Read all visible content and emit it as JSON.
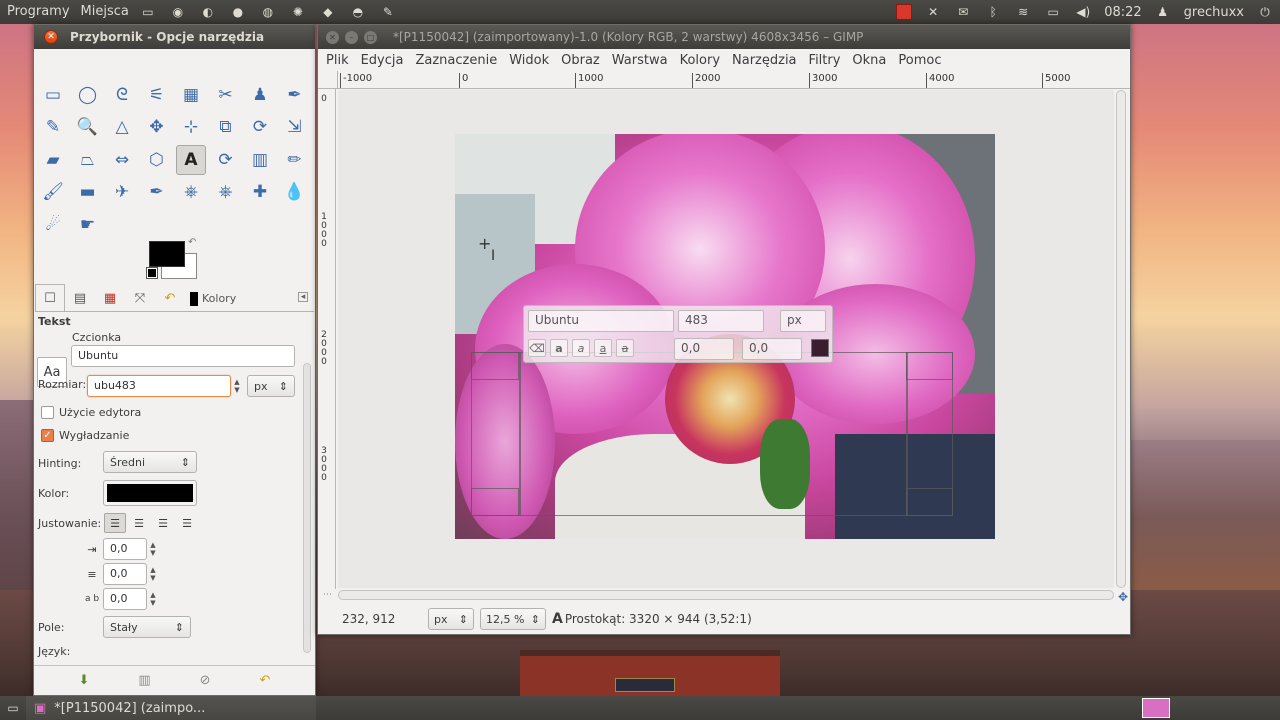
{
  "top_panel": {
    "programs": "Programy",
    "places": "Miejsca",
    "time": "08:22",
    "user": "grechuxx"
  },
  "toolbox": {
    "title": "Przybornik - Opcje narzędzia",
    "tools": [
      "rect-select",
      "ellipse-select",
      "free-select",
      "fuzzy-select",
      "color-select",
      "scissors-select",
      "foreground-select",
      "paths",
      "color-picker",
      "zoom",
      "measure",
      "move",
      "align",
      "crop",
      "rotate",
      "scale",
      "shear",
      "perspective",
      "flip",
      "cage-transform",
      "text",
      "heal",
      "blend",
      "pencil",
      "paintbrush",
      "eraser",
      "airbrush",
      "ink",
      "clone",
      "perspective-clone",
      "heal-bandaid",
      "blur",
      "dodge",
      "smudge"
    ],
    "dock_tab_colors": "Kolory",
    "options": {
      "section": "Tekst",
      "font_label": "Czcionka",
      "font_preview": "Aa",
      "font_value": "Ubuntu",
      "size_label": "Rozmiar:",
      "size_value": "ubu483",
      "size_unit": "px",
      "use_editor": "Użycie edytora",
      "antialias": "Wygładzanie",
      "hinting_label": "Hinting:",
      "hinting_value": "Średni",
      "color_label": "Kolor:",
      "justify_label": "Justowanie:",
      "indent": "0,0",
      "line_spacing": "0,0",
      "letter_spacing": "0,0",
      "box_label": "Pole:",
      "box_value": "Stały",
      "language_label": "Język:"
    }
  },
  "image_window": {
    "title": "*[P1150042] (zaimportowany)-1.0 (Kolory RGB, 2 warstwy) 4608x3456 – GIMP",
    "menu": [
      "Plik",
      "Edycja",
      "Zaznaczenie",
      "Widok",
      "Obraz",
      "Warstwa",
      "Kolory",
      "Narzędzia",
      "Filtry",
      "Okna",
      "Pomoc"
    ],
    "hruler": [
      "-1000",
      "0",
      "1000",
      "2000",
      "3000",
      "4000",
      "5000"
    ],
    "vruler": [
      "0",
      "1000",
      "2000",
      "3000"
    ],
    "text_toolbar": {
      "font": "Ubuntu",
      "size": "483",
      "unit": "px",
      "baseline": "0,0",
      "kerning": "0,0"
    },
    "status": {
      "coords": "232, 912",
      "unit": "px",
      "zoom": "12,5 %",
      "message": "Prostokąt: 3320 × 944  (3,52:1)"
    }
  },
  "taskbar": {
    "item": "*[P1150042] (zaimpo..."
  },
  "colors": {
    "accent": "#e97f4c",
    "foreground": "#000000",
    "background": "#ffffff"
  }
}
